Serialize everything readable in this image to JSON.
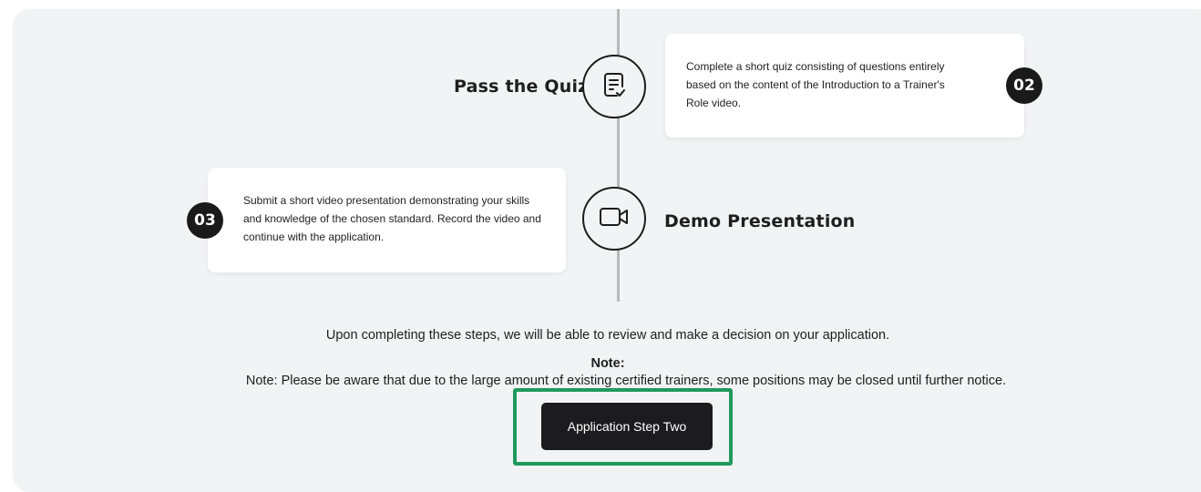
{
  "timeline": {
    "steps": [
      {
        "title": "Pass the Quiz",
        "number": "02",
        "icon": "quiz-icon",
        "description": "Complete a short quiz consisting of questions entirely based on the content of the Introduction to a Trainer's Role video."
      },
      {
        "title": "Demo Presentation",
        "number": "03",
        "icon": "video-camera-icon",
        "description": "Submit a short video presentation demonstrating your skills and knowledge of the chosen standard. Record the video and continue with the application."
      }
    ]
  },
  "footer": {
    "summary": "Upon completing these steps, we will be able to review and make a decision on your application.",
    "note_heading": "Note:",
    "note_text": "Note: Please be aware that due to the large amount of existing certified trainers, some positions may be closed until further notice."
  },
  "action": {
    "button_label": "Application Step Two"
  },
  "colors": {
    "panel_bg": "#f2f3f5",
    "button_bg": "#1c1c1e",
    "highlight": "#1f9a5c"
  }
}
